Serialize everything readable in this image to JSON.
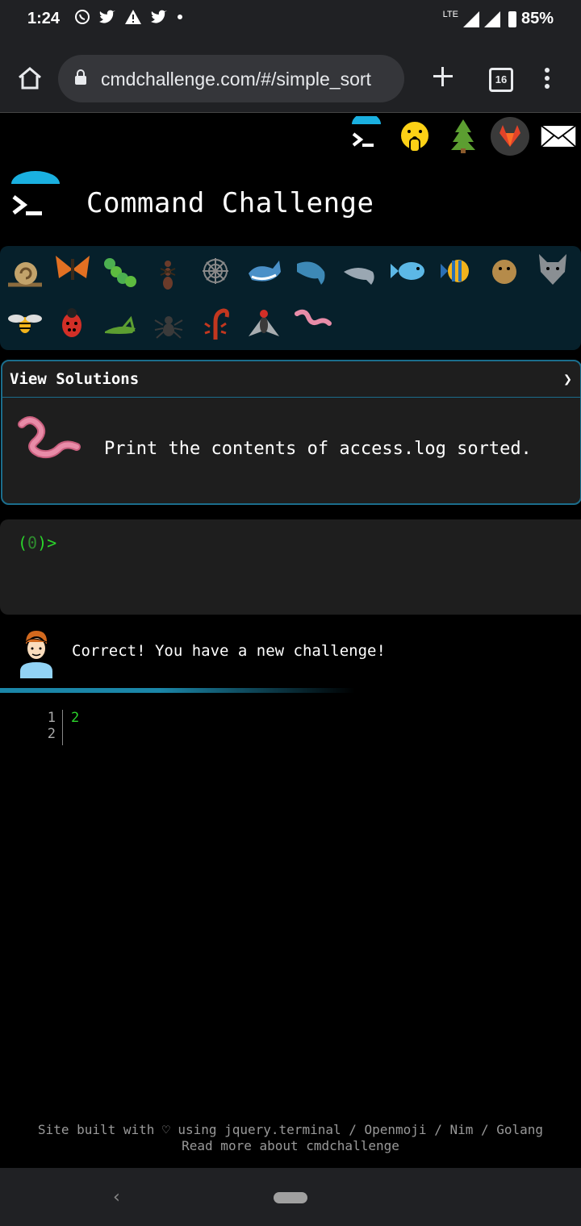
{
  "status_bar": {
    "time": "1:24",
    "notification_icons": [
      "whatsapp-icon",
      "twitter-icon",
      "warning-icon",
      "twitter-icon",
      "dot-icon"
    ],
    "network": "LTE",
    "battery": "85%"
  },
  "browser": {
    "url": "cmdchallenge.com/#/simple_sort",
    "tab_count": "16"
  },
  "header": {
    "icons": [
      "terminal-logo-icon",
      "shushing-face-icon",
      "tree-icon",
      "gitlab-icon",
      "envelope-icon"
    ],
    "title": "Command Challenge"
  },
  "animals": {
    "row1": [
      "snail",
      "butterfly",
      "caterpillar",
      "ant",
      "spider-web",
      "whale",
      "dolphin",
      "dolphin",
      "fish",
      "tropical-fish",
      "blowfish",
      "wolf"
    ],
    "row2": [
      "bee",
      "ladybug",
      "cricket",
      "spider",
      "scorpion",
      "fly",
      "worm"
    ]
  },
  "challenge": {
    "header_label": "View Solutions",
    "chevron": "❯",
    "description": "Print the contents of access.log sorted."
  },
  "terminal": {
    "prompt_open": "(",
    "prompt_count": "0",
    "prompt_close": ")>"
  },
  "result": {
    "message": "Correct! You have a new challenge!"
  },
  "editor": {
    "line_numbers": [
      "1",
      "2"
    ],
    "lines": [
      "2",
      ""
    ]
  },
  "footer": {
    "line1": "Site built with ♡ using jquery.terminal / Openmoji / Nim / Golang",
    "line2": "Read more about cmdchallenge"
  },
  "colors": {
    "accent": "#1b86a8",
    "prompt_green": "#2bd42b",
    "background": "#000000"
  }
}
